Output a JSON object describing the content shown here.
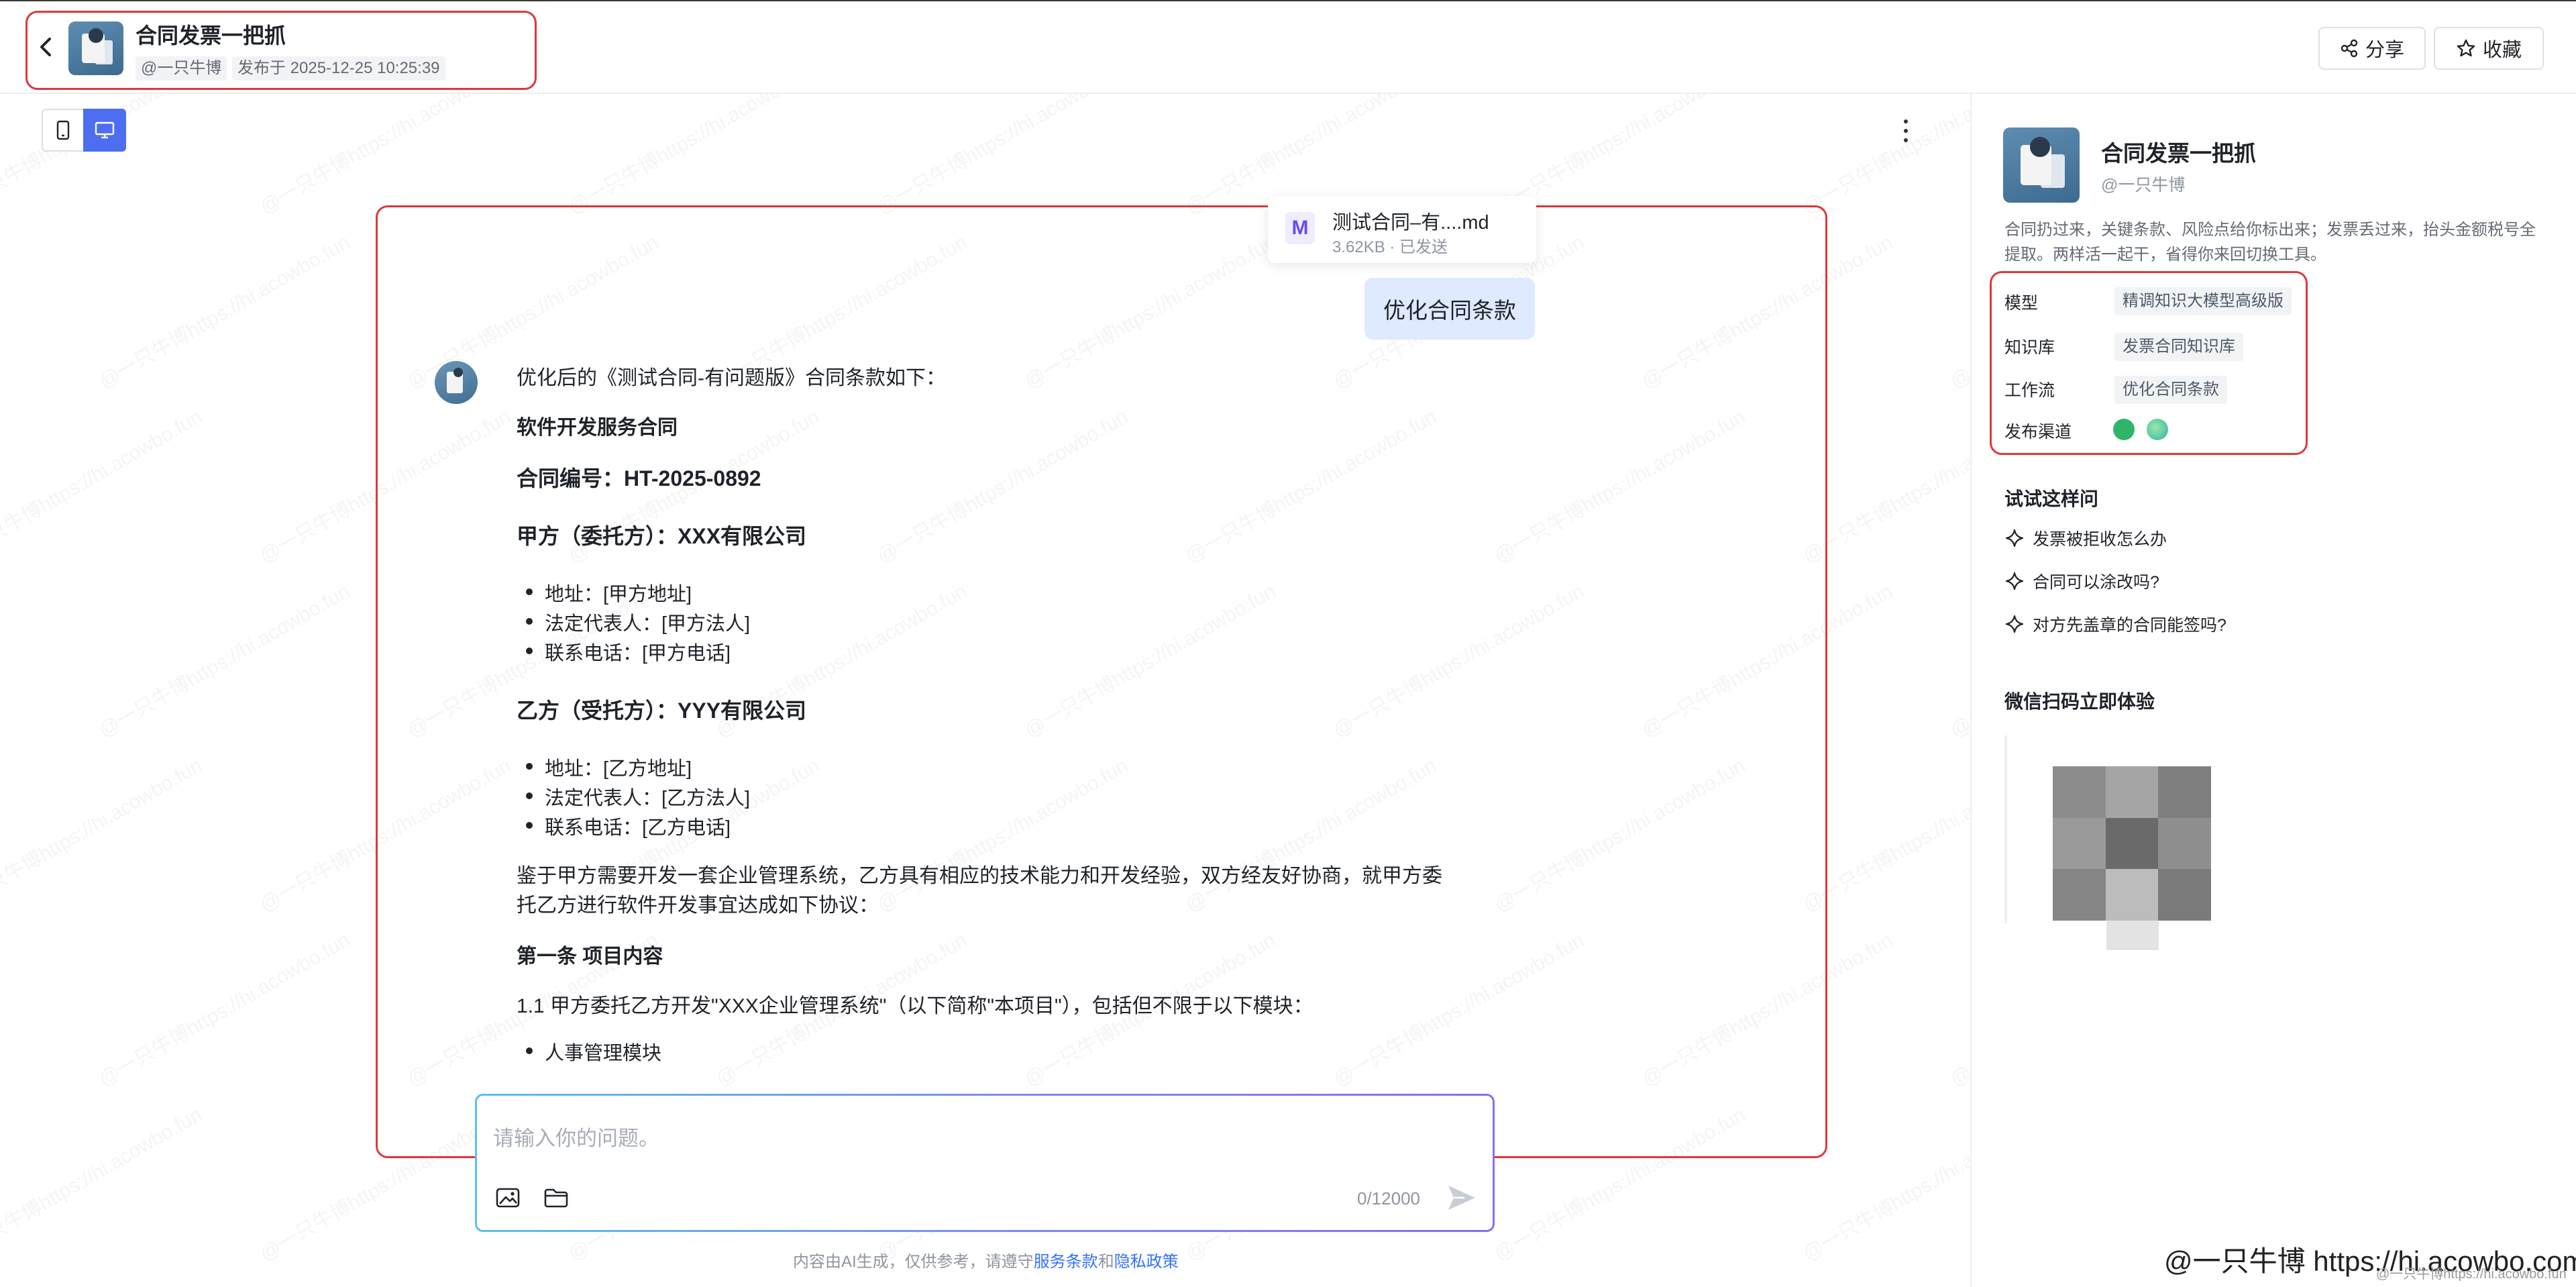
{
  "header": {
    "app_title": "合同发票一把抓",
    "author": "@一只牛博",
    "published": "发布于 2025-12-25 10:25:39",
    "share_label": "分享",
    "favorite_label": "收藏"
  },
  "chat": {
    "file": {
      "icon_letter": "M",
      "name": "测试合同–有....md",
      "meta": "3.62KB · 已发送"
    },
    "user_message": "优化合同条款",
    "reply": {
      "intro": "优化后的《测试合同-有问题版》合同条款如下：",
      "heading": "软件开发服务合同",
      "contract_no": "合同编号：HT-2025-0892",
      "party_a": "甲方（委托方）：XXX有限公司",
      "party_a_items": [
        "地址：[甲方地址]",
        "法定代表人：[甲方法人]",
        "联系电话：[甲方电话]"
      ],
      "party_b": "乙方（受托方）：YYY有限公司",
      "party_b_items": [
        "地址：[乙方地址]",
        "法定代表人：[乙方法人]",
        "联系电话：[乙方电话]"
      ],
      "preamble_line1": "鉴于甲方需要开发一套企业管理系统，乙方具有相应的技术能力和开发经验，双方经友好协商，就甲方委",
      "preamble_line2": "托乙方进行软件开发事宜达成如下协议：",
      "article1": "第一条 项目内容",
      "clause_1_1": "1.1 甲方委托乙方开发\"XXX企业管理系统\"（以下简称\"本项目\"），包括但不限于以下模块：",
      "modules": [
        "人事管理模块"
      ]
    },
    "input": {
      "placeholder": "请输入你的问题。",
      "counter": "0/12000"
    },
    "disclaimer": {
      "prefix": "内容由AI生成，仅供参考，请遵守",
      "terms": "服务条款",
      "and": "和",
      "privacy": "隐私政策"
    }
  },
  "sidebar": {
    "title": "合同发票一把抓",
    "author": "@一只牛博",
    "description": "合同扔过来，关键条款、风险点给你标出来；发票丢过来，抬头金额税号全提取。两样活一起干，省得你来回切换工具。",
    "config": [
      {
        "label": "模型",
        "value": "精调知识大模型高级版"
      },
      {
        "label": "知识库",
        "value": "发票合同知识库"
      },
      {
        "label": "工作流",
        "value": "优化合同条款"
      }
    ],
    "channel_label": "发布渠道",
    "try_title": "试试这样问",
    "suggestions": [
      "发票被拒收怎么办",
      "合同可以涂改吗?",
      "对方先盖章的合同能签吗?"
    ],
    "qr_title": "微信扫码立即体验"
  },
  "watermark": {
    "corner_main": "@一只牛博 https://hi.acowbo.com",
    "corner_small": "@一只牛博https://hi.acowbo.fun"
  },
  "colors": {
    "accent": "#4e6ef2",
    "highlight_box": "#e0383b",
    "user_bubble": "#dfe9ff",
    "link": "#3370ff"
  }
}
